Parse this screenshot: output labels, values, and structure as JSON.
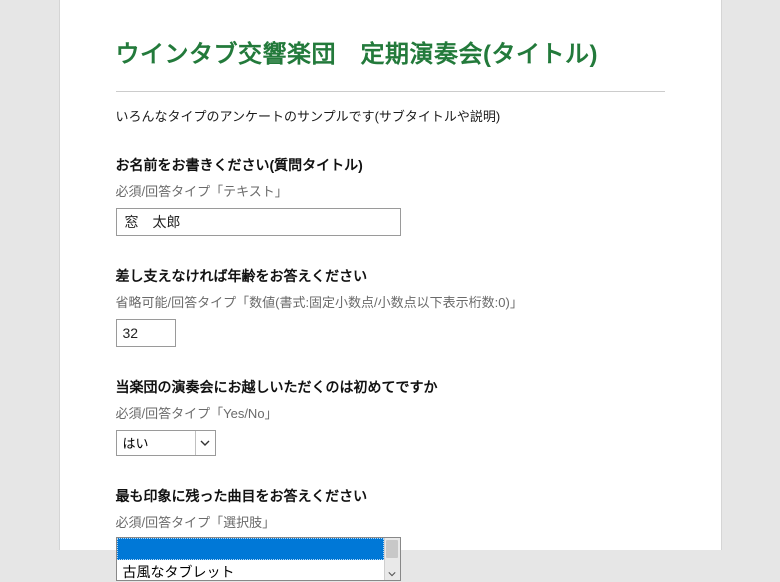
{
  "title": "ウインタブ交響楽団　定期演奏会(タイトル)",
  "subtitle": "いろんなタイプのアンケートのサンプルです(サブタイトルや説明)",
  "q1": {
    "title": "お名前をお書きください(質問タイトル)",
    "help": "必須/回答タイプ「テキスト」",
    "value": "窓　太郎"
  },
  "q2": {
    "title": "差し支えなければ年齢をお答えください",
    "help": "省略可能/回答タイプ「数値(書式:固定小数点/小数点以下表示桁数:0)」",
    "value": "32"
  },
  "q3": {
    "title": "当楽団の演奏会にお越しいただくのは初めてですか",
    "help": "必須/回答タイプ「Yes/No」",
    "value": "はい"
  },
  "q4": {
    "title": "最も印象に残った曲目をお答えください",
    "help": "必須/回答タイプ「選択肢」",
    "selected_blank": "",
    "visible_option": "古風なタブレット"
  }
}
